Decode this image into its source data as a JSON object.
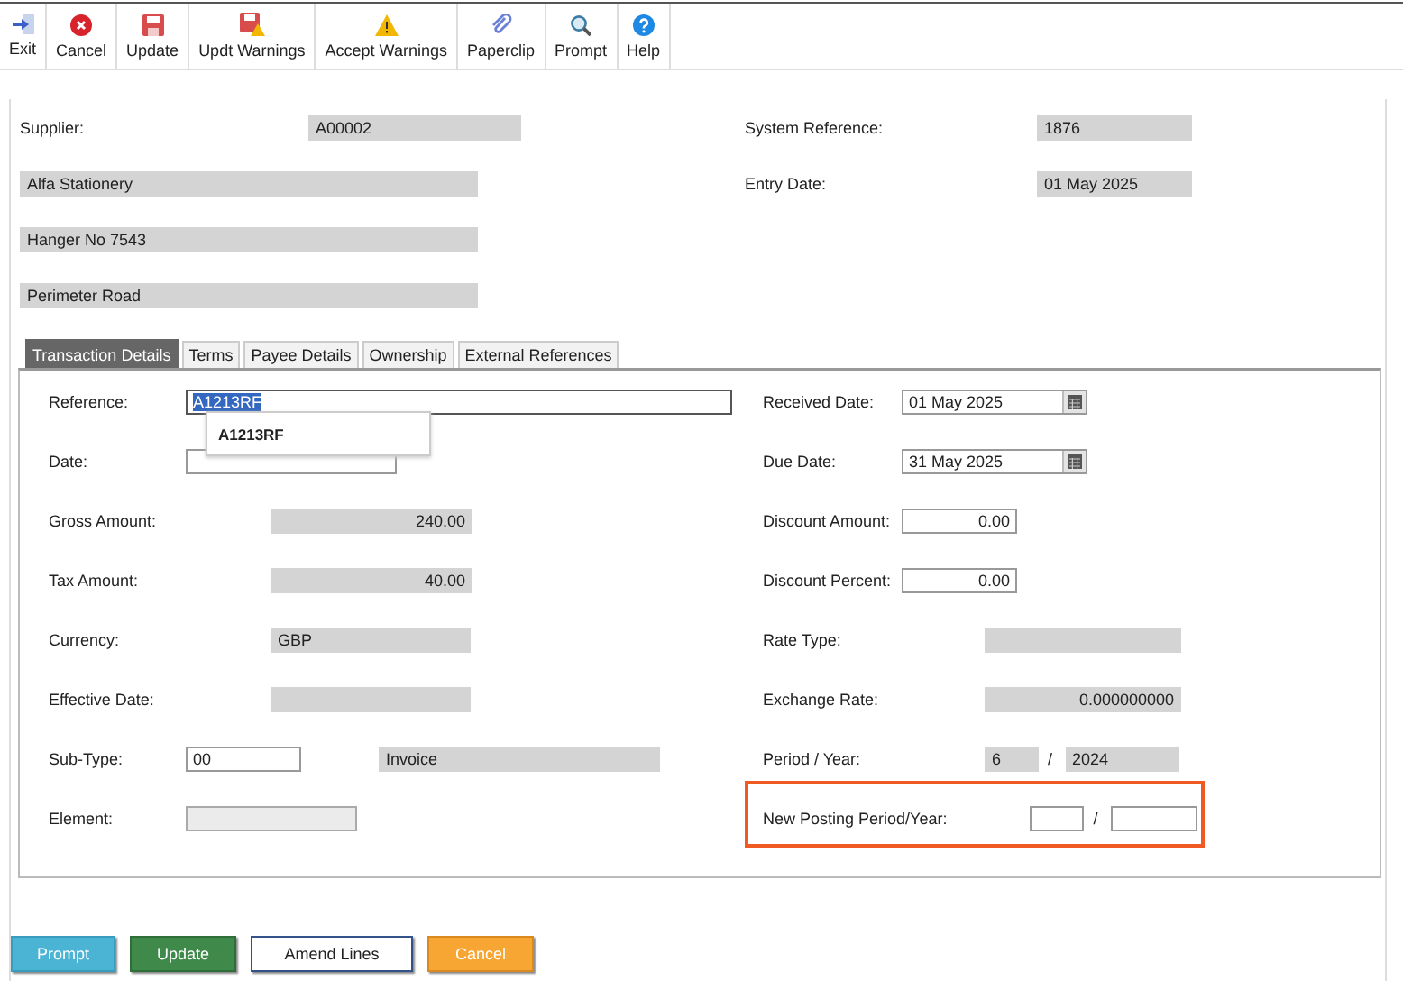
{
  "toolbar": [
    {
      "kind": "exit",
      "label": "Exit"
    },
    {
      "kind": "cancel",
      "label": "Cancel"
    },
    {
      "kind": "update",
      "label": "Update"
    },
    {
      "kind": "updt-warnings",
      "label": "Updt Warnings"
    },
    {
      "kind": "warning",
      "label": "Accept Warnings"
    },
    {
      "kind": "paperclip",
      "label": "Paperclip"
    },
    {
      "kind": "prompt",
      "label": "Prompt"
    },
    {
      "kind": "help",
      "label": "Help"
    }
  ],
  "header": {
    "left": [
      {
        "label": "Supplier:",
        "value": "A00002"
      },
      {
        "value": "Alfa Stationery"
      },
      {
        "value": "Hanger No 7543"
      },
      {
        "value": "Perimeter Road"
      }
    ],
    "right": [
      {
        "label": "System Reference:",
        "value": "1876"
      },
      {
        "label": "Entry Date:",
        "value": "01 May 2025"
      }
    ]
  },
  "tabs": [
    {
      "label": "Transaction Details",
      "selected": true
    },
    {
      "label": "Terms",
      "selected": false
    },
    {
      "label": "Payee Details",
      "selected": false
    },
    {
      "label": "Ownership",
      "selected": false
    },
    {
      "label": "External References",
      "selected": false
    }
  ],
  "panel": {
    "rows": [
      {
        "left": {
          "label": "Reference:",
          "fields": [
            {
              "kind": "input",
              "value": "A1213RF",
              "selected": true
            }
          ]
        },
        "right": {
          "label": "Received Date:",
          "fields": [
            {
              "kind": "date",
              "value": "01 May 2025"
            }
          ]
        }
      },
      {
        "left": {
          "label": "Date:",
          "fields": [
            {
              "kind": "date"
            }
          ]
        },
        "right": {
          "label": "Due Date:",
          "fields": [
            {
              "kind": "date",
              "value": "31 May 2025"
            }
          ]
        }
      },
      {
        "left": {
          "label": "Gross Amount:",
          "fields": [
            {
              "kind": "readonly",
              "value": "240.00",
              "numeric": true
            }
          ]
        },
        "right": {
          "label": "Discount Amount:",
          "fields": [
            {
              "kind": "input",
              "value": "0.00",
              "numeric": true
            }
          ]
        }
      },
      {
        "left": {
          "label": "Tax Amount:",
          "fields": [
            {
              "kind": "readonly",
              "value": "40.00",
              "numeric": true
            }
          ]
        },
        "right": {
          "label": "Discount Percent:",
          "fields": [
            {
              "kind": "input",
              "value": "0.00",
              "numeric": true
            }
          ]
        }
      },
      {
        "left": {
          "label": "Currency:",
          "fields": [
            {
              "kind": "readonly",
              "value": "GBP"
            }
          ]
        },
        "right": {
          "label": "Rate Type:",
          "fields": [
            {
              "kind": "readonly"
            }
          ]
        }
      },
      {
        "left": {
          "label": "Effective Date:",
          "fields": [
            {
              "kind": "readonly"
            }
          ]
        },
        "right": {
          "label": "Exchange Rate:",
          "fields": [
            {
              "kind": "readonly",
              "value": "0.000000000",
              "numeric": true
            }
          ]
        }
      },
      {
        "left": {
          "label": "Sub-Type:",
          "fields": [
            {
              "kind": "input",
              "value": "00"
            },
            {
              "kind": "readonly",
              "value": "Invoice"
            }
          ]
        },
        "right": {
          "label": "Period / Year:",
          "fields": [
            {
              "kind": "readonly",
              "value": "6"
            },
            {
              "kind": "separator",
              "text": "/"
            },
            {
              "kind": "readonly",
              "value": "2024"
            }
          ]
        }
      },
      {
        "left": {
          "label": "Element:",
          "fields": [
            {
              "kind": "disabled"
            }
          ]
        },
        "right": {
          "label": "New Posting Period/Year:",
          "highlighted": true,
          "fields": [
            {
              "kind": "input"
            },
            {
              "kind": "separator",
              "text": "/"
            },
            {
              "kind": "input"
            }
          ]
        }
      }
    ]
  },
  "suggestion": {
    "value": "A1213RF"
  },
  "buttons": [
    {
      "kind": "prompt",
      "label": "Prompt"
    },
    {
      "kind": "update",
      "label": "Update"
    },
    {
      "kind": "amend",
      "label": "Amend Lines"
    },
    {
      "kind": "cancel",
      "label": "Cancel"
    }
  ]
}
